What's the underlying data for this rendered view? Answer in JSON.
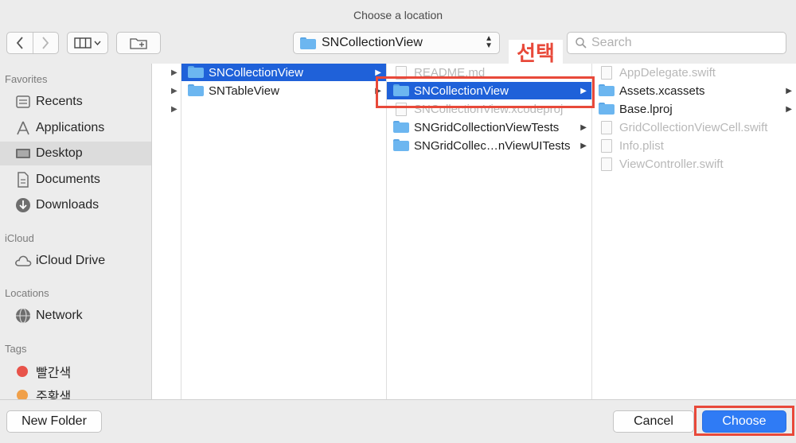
{
  "window": {
    "title": "Choose a location"
  },
  "toolbar": {
    "back_icon": "chevron-left-icon",
    "forward_icon": "chevron-right-icon",
    "view_icon": "column-view-icon",
    "new_folder_icon": "new-folder-icon",
    "location": "SNCollectionView",
    "search_placeholder": "Search"
  },
  "annotation": {
    "text": "선택",
    "color": "#e8493a"
  },
  "sidebar": {
    "sections": [
      {
        "heading": "Favorites",
        "items": [
          {
            "label": "Recents",
            "icon": "recents-icon"
          },
          {
            "label": "Applications",
            "icon": "applications-icon"
          },
          {
            "label": "Desktop",
            "icon": "desktop-icon",
            "selected": true
          },
          {
            "label": "Documents",
            "icon": "documents-icon"
          },
          {
            "label": "Downloads",
            "icon": "downloads-icon"
          }
        ]
      },
      {
        "heading": "iCloud",
        "items": [
          {
            "label": "iCloud Drive",
            "icon": "cloud-icon"
          }
        ]
      },
      {
        "heading": "Locations",
        "items": [
          {
            "label": "Network",
            "icon": "network-icon"
          }
        ]
      },
      {
        "heading": "Tags",
        "items": [
          {
            "label": "빨간색",
            "color": "#e8534a"
          },
          {
            "label": "주황색",
            "color": "#f0a04a"
          }
        ]
      }
    ]
  },
  "columns": {
    "col1": [
      {
        "label": "SNCollectionView",
        "type": "folder",
        "selected": true,
        "arrow": true
      },
      {
        "label": "SNTableView",
        "type": "folder",
        "arrow": true
      }
    ],
    "col2": [
      {
        "label": "README.md",
        "type": "file",
        "dim": true
      },
      {
        "label": "SNCollectionView",
        "type": "folder",
        "selected": true,
        "arrow": true
      },
      {
        "label": "SNCollectionView.xcodeproj",
        "type": "file",
        "dim": true
      },
      {
        "label": "SNGridCollectionViewTests",
        "type": "folder",
        "arrow": true
      },
      {
        "label": "SNGridCollec…nViewUITests",
        "type": "folder",
        "arrow": true
      }
    ],
    "col3": [
      {
        "label": "AppDelegate.swift",
        "type": "file",
        "dim": true
      },
      {
        "label": "Assets.xcassets",
        "type": "folder",
        "arrow": true
      },
      {
        "label": "Base.lproj",
        "type": "folder",
        "arrow": true
      },
      {
        "label": "GridCollectionViewCell.swift",
        "type": "file",
        "dim": true
      },
      {
        "label": "Info.plist",
        "type": "file",
        "dim": true
      },
      {
        "label": "ViewController.swift",
        "type": "file",
        "dim": true
      }
    ]
  },
  "footer": {
    "new_folder": "New Folder",
    "cancel": "Cancel",
    "choose": "Choose"
  },
  "colors": {
    "selection": "#1f61d9",
    "primary_button": "#2f7bf5",
    "annotation": "#e8493a"
  }
}
